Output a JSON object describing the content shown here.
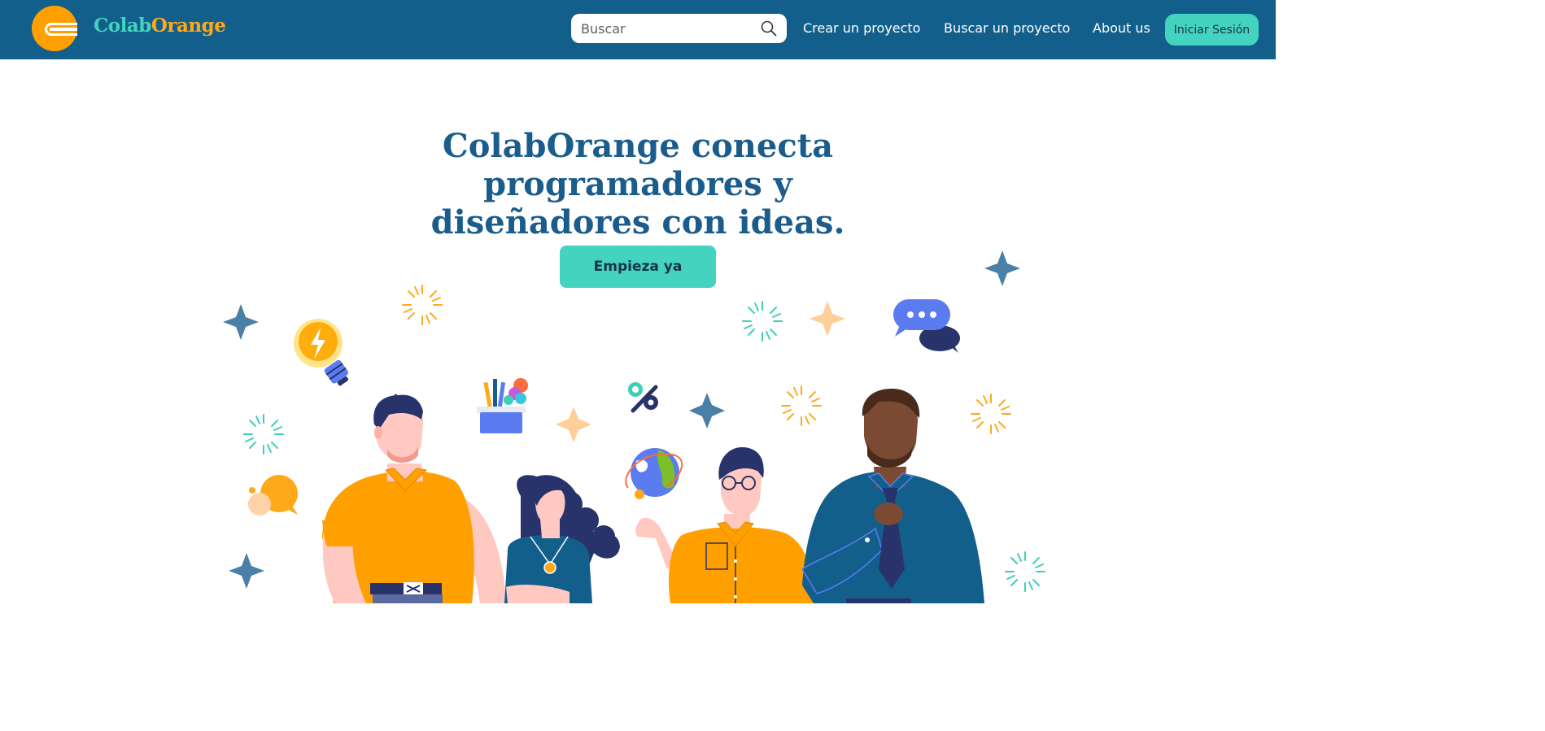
{
  "navbar": {
    "brand_part1": "Colab",
    "brand_part2": "Orange",
    "search_placeholder": "Buscar",
    "links": [
      "Crear un proyecto",
      "Buscar un proyecto",
      "About us"
    ],
    "login_label": "Iniciar Sesión"
  },
  "hero": {
    "title_line1": "ColabOrange conecta programadores y",
    "title_line2": "diseñadores con ideas.",
    "cta_label": "Empieza ya"
  },
  "colors": {
    "navbar_bg": "#135f8c",
    "accent_teal": "#44d3bf",
    "accent_orange": "#ff9f00",
    "title_blue": "#1a5d8c"
  },
  "icons": {
    "logo": "colab-orange-logo-icon",
    "search": "search-icon"
  }
}
